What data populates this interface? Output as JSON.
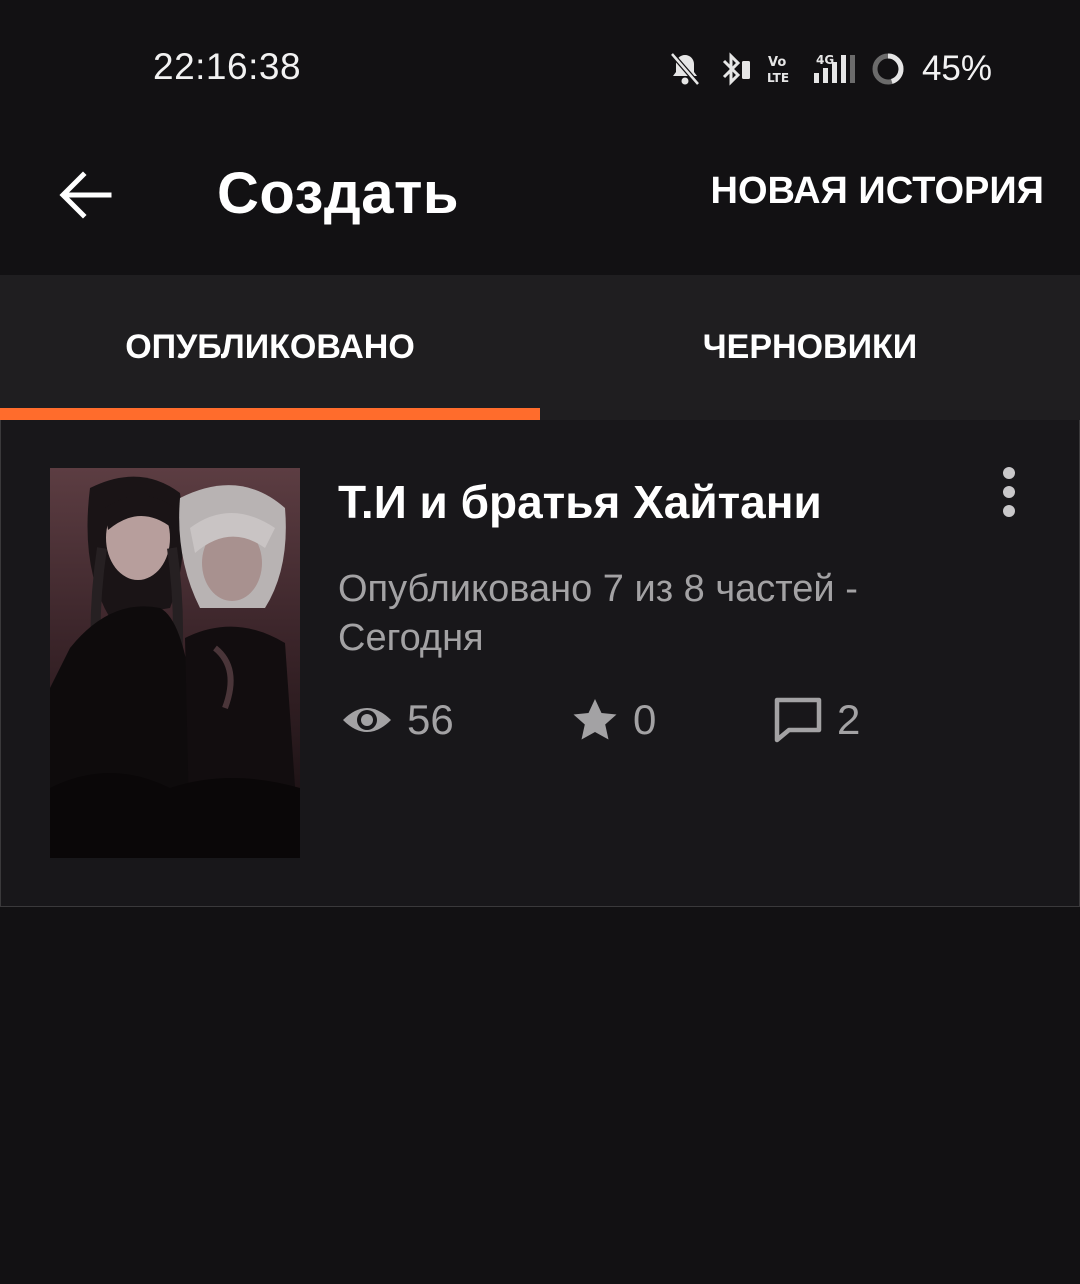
{
  "status_bar": {
    "time": "22:16:38",
    "battery": "45%",
    "icons": [
      "notifications-off-icon",
      "bluetooth-icon",
      "volte-icon",
      "signal-4g-icon",
      "battery-ring-icon"
    ]
  },
  "app_bar": {
    "title": "Создать",
    "action_label": "НОВАЯ ИСТОРИЯ",
    "back_icon": "arrow-back-icon"
  },
  "tabs": {
    "items": [
      {
        "label": "ОПУБЛИКОВАНО",
        "selected": true
      },
      {
        "label": "ЧЕРНОВИКИ",
        "selected": false
      }
    ],
    "accent_color": "#ff6c2c"
  },
  "stories": [
    {
      "title": "Т.И и братья Хайтани",
      "meta": "Опубликовано 7 из 8 частей - Сегодня",
      "views": "56",
      "votes": "0",
      "comments": "2"
    }
  ]
}
